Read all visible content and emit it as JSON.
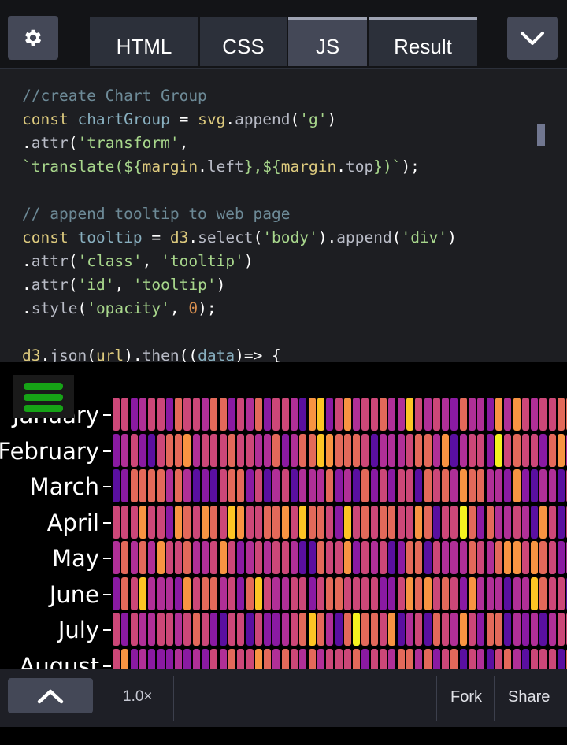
{
  "tabs": [
    {
      "label": "HTML",
      "active": false
    },
    {
      "label": "CSS",
      "active": false
    },
    {
      "label": "JS",
      "active": true
    },
    {
      "label": "Result",
      "active": false
    }
  ],
  "icons": {
    "settings": "gear-icon",
    "collapse": "chevron-down-icon",
    "menu": "hamburger-menu-icon",
    "expand": "chevron-up-icon"
  },
  "code_lines": [
    "//create Chart Group",
    "const chartGroup = svg.append('g')",
    ".attr('transform',",
    "`translate(${margin.left},${margin.top})`);",
    "",
    "// append tooltip to web page",
    "const tooltip = d3.select('body').append('div')",
    ".attr('class', 'tooltip')",
    ".attr('id', 'tooltip')",
    ".style('opacity', 0);",
    "",
    "d3.json(url).then((data)=> {"
  ],
  "chart_data": {
    "type": "heatmap",
    "y_categories": [
      "January",
      "February",
      "March",
      "April",
      "May",
      "June",
      "July",
      "August"
    ],
    "color_scale": [
      "#5a0fa0",
      "#8a1aa2",
      "#b02f97",
      "#cc4778",
      "#e3695a",
      "#f89442",
      "#fdc524",
      "#f5f21f"
    ],
    "legend": "none"
  },
  "bottom_bar": {
    "zoom": "1.0×",
    "fork_label": "Fork",
    "share_label": "Share"
  }
}
